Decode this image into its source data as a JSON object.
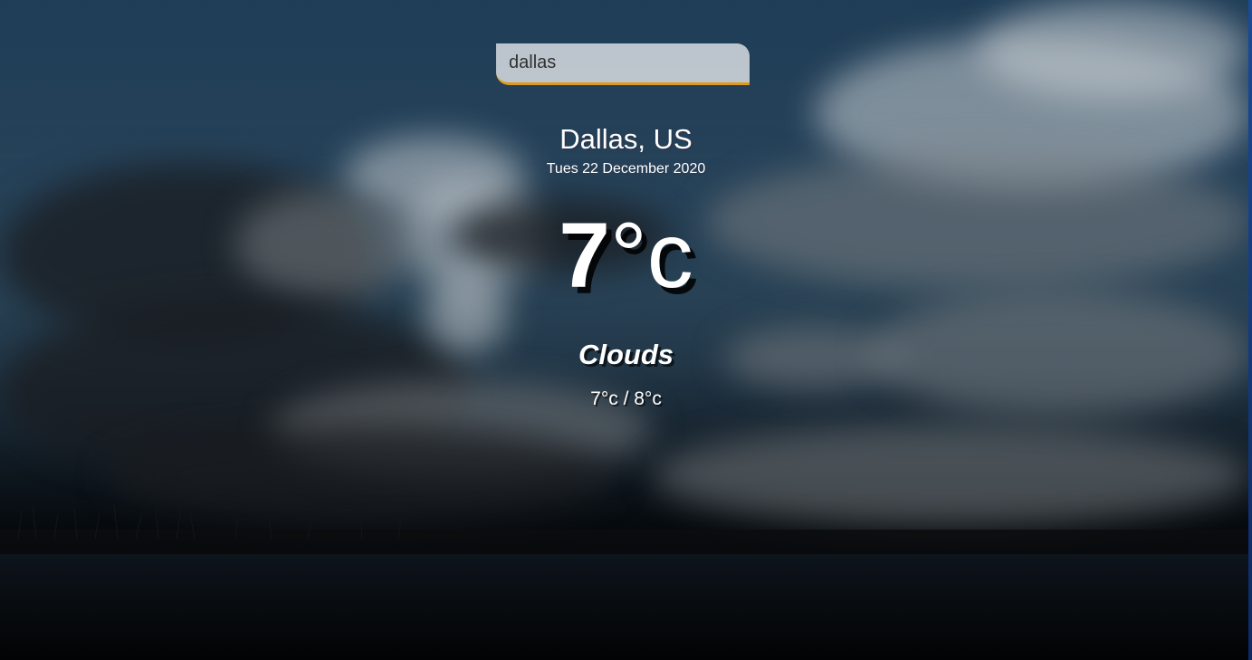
{
  "search": {
    "value": "dallas"
  },
  "location": {
    "name": "Dallas, US",
    "date": "Tues 22 December 2020"
  },
  "weather": {
    "temperature": "7",
    "unit": "°c",
    "condition": "Clouds",
    "min_max": "7°c / 8°c"
  },
  "colors": {
    "search_underline": "#df9a1b",
    "text": "#ffffff"
  }
}
